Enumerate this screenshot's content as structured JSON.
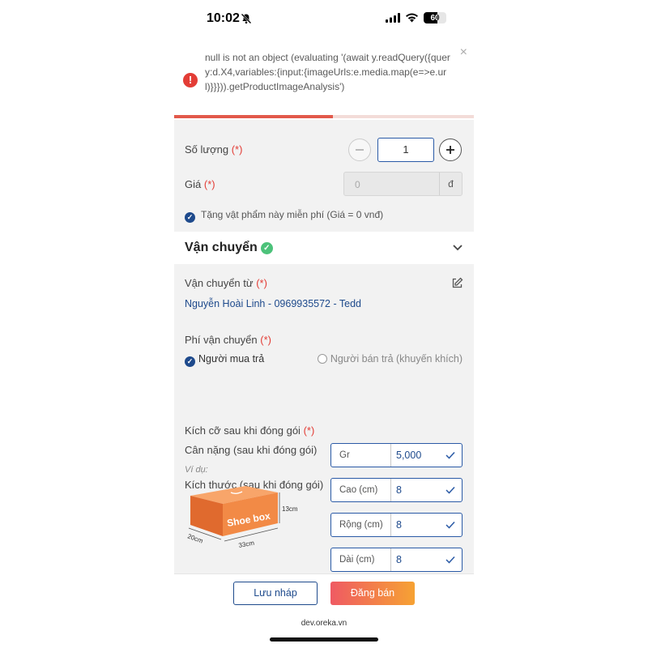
{
  "status_bar": {
    "time": "10:02",
    "battery": "60",
    "battery_level": 0.6
  },
  "toast": {
    "message": "null is not an object (evaluating '(await y.readQuery({query:d.X4,variables:{input:{imageUrls:e.media.map(e=>e.url)}}})).getProductImageAnalysis')",
    "close": "×",
    "progress": 0.53
  },
  "product": {
    "quantity_label": "Số lượng",
    "required": "(*)",
    "quantity_value": "1",
    "price_label": "Giá",
    "price_placeholder": "0",
    "price_unit": "đ",
    "free_label": "Tặng vật phẩm này miễn phí (Giá = 0 vnđ)"
  },
  "shipping": {
    "title": "Vận chuyển",
    "from_label": "Vận chuyển từ",
    "from_value": "Nguyễn Hoài Linh - 0969935572 - Tedd",
    "fee_label": "Phí vận chuyển",
    "buyer_pays": "Người mua trả",
    "seller_pays": "Người bán trả (khuyến khích)",
    "package_size_label": "Kích cỡ sau khi đóng gói",
    "weight_label": "Cân nặng (sau khi đóng gói)",
    "dimension_label": "Kích thước (sau khi đóng gói)",
    "example_label": "Ví dụ:",
    "weight": {
      "label": "Gr",
      "value": "5,000"
    },
    "height": {
      "label": "Cao (cm)",
      "value": "8"
    },
    "width": {
      "label": "Rộng (cm)",
      "value": "8"
    },
    "length": {
      "label": "Dài (cm)",
      "value": "8"
    },
    "box_text": "Shoe box",
    "box_height": "13cm",
    "box_length": "33cm",
    "box_depth": "20cm"
  },
  "footer": {
    "draft": "Lưu nháp",
    "publish": "Đăng bán"
  },
  "domain": "dev.oreka.vn",
  "colors": {
    "accent_blue": "#1e4a8c",
    "error_red": "#e33d36",
    "success_green": "#4cc27a",
    "publish_start": "#ef5a63",
    "publish_end": "#f6a233"
  }
}
